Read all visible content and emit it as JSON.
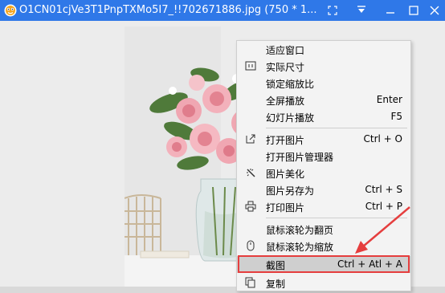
{
  "window": {
    "title": "O1CN01cjVe3T1PnpTXMo5I7_!!702671886.jpg (750 * 1...",
    "controls": [
      "fullscreen-icon",
      "pin-icon",
      "minimize-icon",
      "maximize-icon",
      "close-icon"
    ],
    "accent": "#2f78e8"
  },
  "menu": {
    "items": [
      {
        "label": "适应窗口",
        "shortcut": "",
        "icon": ""
      },
      {
        "label": "实际尺寸",
        "shortcut": "",
        "icon": "actual-size-icon"
      },
      {
        "label": "锁定缩放比",
        "shortcut": "",
        "icon": ""
      },
      {
        "label": "全屏播放",
        "shortcut": "Enter",
        "icon": ""
      },
      {
        "label": "幻灯片播放",
        "shortcut": "F5",
        "icon": ""
      },
      {
        "label": "打开图片",
        "shortcut": "Ctrl + O",
        "icon": "open-image-icon"
      },
      {
        "label": "打开图片管理器",
        "shortcut": "",
        "icon": ""
      },
      {
        "label": "图片美化",
        "shortcut": "",
        "icon": "magic-wand-icon"
      },
      {
        "label": "图片另存为",
        "shortcut": "Ctrl + S",
        "icon": ""
      },
      {
        "label": "打印图片",
        "shortcut": "Ctrl + P",
        "icon": "printer-icon"
      },
      {
        "label": "鼠标滚轮为翻页",
        "shortcut": "",
        "icon": ""
      },
      {
        "label": "鼠标滚轮为缩放",
        "shortcut": "",
        "icon": "mouse-icon"
      },
      {
        "label": "截图",
        "shortcut": "Ctrl + Atl + A",
        "icon": ""
      },
      {
        "label": "复制",
        "shortcut": "",
        "icon": "copy-icon"
      }
    ],
    "highlighted": "截图",
    "highlight_color": "#e53e3e"
  }
}
